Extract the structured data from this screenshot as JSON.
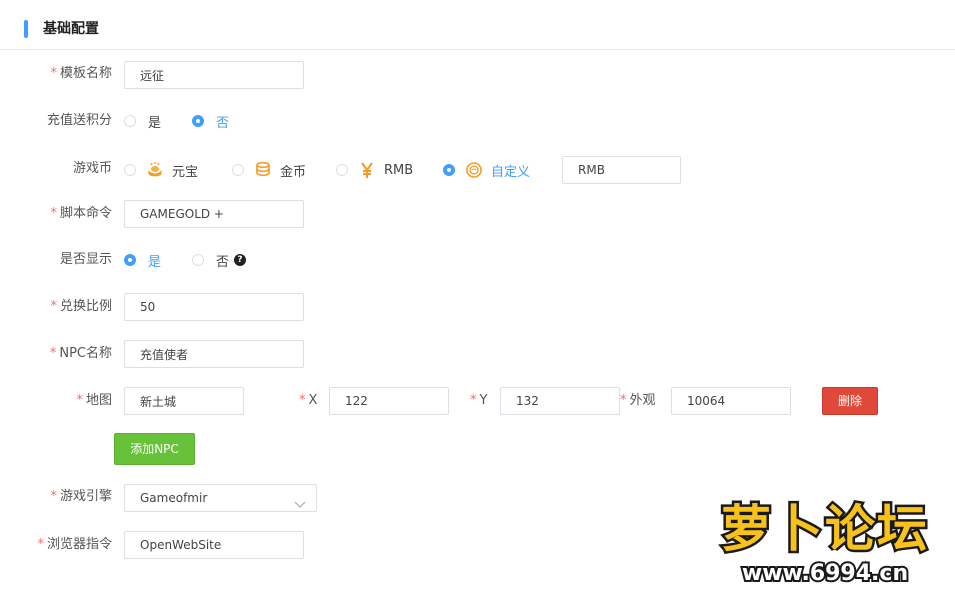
{
  "section": {
    "title": "基础配置"
  },
  "form": {
    "template_name": {
      "label": "模板名称",
      "value": "远征"
    },
    "recharge_points": {
      "label": "充值送积分",
      "options": [
        "是",
        "否"
      ],
      "selected": "否"
    },
    "game_currency": {
      "label": "游戏币",
      "options": [
        {
          "label": "元宝",
          "icon": "ingot-icon"
        },
        {
          "label": "金币",
          "icon": "gold-coins-icon"
        },
        {
          "label": "RMB",
          "icon": "yen-icon"
        },
        {
          "label": "自定义",
          "icon": "custom-coin-icon"
        }
      ],
      "selected": "自定义",
      "custom_value": "RMB"
    },
    "script_command": {
      "label": "脚本命令",
      "value": "GAMEGOLD +"
    },
    "display": {
      "label": "是否显示",
      "options": [
        "是",
        "否"
      ],
      "selected": "是",
      "help": "?"
    },
    "exchange_ratio": {
      "label": "兑换比例",
      "value": "50"
    },
    "npc_name": {
      "label": "NPC名称",
      "value": "充值使者"
    },
    "npc": {
      "map_label": "地图",
      "map_value": "新土城",
      "x_label": "X",
      "x_value": "122",
      "y_label": "Y",
      "y_value": "132",
      "look_label": "外观",
      "look_value": "10064",
      "delete_label": "删除",
      "add_label": "添加NPC"
    },
    "game_engine": {
      "label": "游戏引擎",
      "value": "Gameofmir"
    },
    "browser_command": {
      "label": "浏览器指令",
      "value": "OpenWebSite"
    },
    "required_mark": "*"
  },
  "watermark": {
    "text1": "萝卜论坛",
    "text2": "www.6994.cn"
  },
  "colors": {
    "primary": "#409eff",
    "danger": "#e0483a",
    "success": "#67c23a",
    "required": "#f56c6c"
  }
}
